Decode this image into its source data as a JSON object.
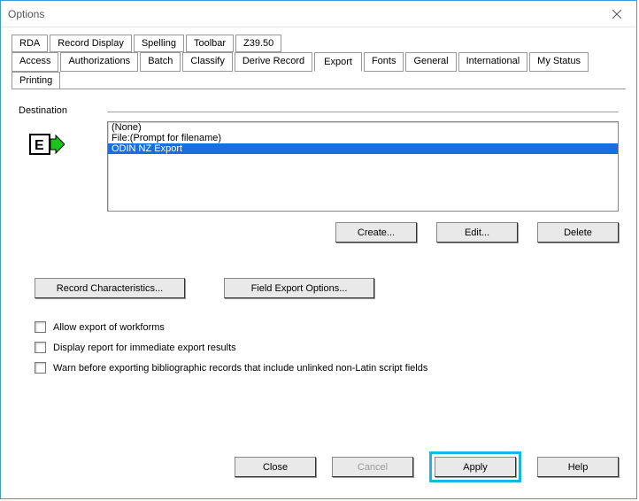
{
  "window": {
    "title": "Options"
  },
  "tabs": {
    "row1": [
      "RDA",
      "Record Display",
      "Spelling",
      "Toolbar",
      "Z39.50"
    ],
    "row2": [
      "Access",
      "Authorizations",
      "Batch",
      "Classify",
      "Derive Record",
      "Export",
      "Fonts",
      "General",
      "International",
      "My Status",
      "Printing"
    ],
    "active": "Export"
  },
  "destination": {
    "label": "Destination",
    "items": [
      "(None)",
      "File:(Prompt for filename)",
      "ODIN NZ Export"
    ],
    "selected_index": 2
  },
  "buttons": {
    "create": "Create...",
    "edit": "Edit...",
    "delete": "Delete",
    "record_characteristics": "Record Characteristics...",
    "field_export_options": "Field Export Options...",
    "close": "Close",
    "cancel": "Cancel",
    "apply": "Apply",
    "help": "Help"
  },
  "checkboxes": {
    "allow_export_workforms": "Allow export of workforms",
    "display_report_immediate": "Display report for immediate export results",
    "warn_unlinked_nonlatin": "Warn before exporting bibliographic records that include unlinked non-Latin script fields"
  }
}
